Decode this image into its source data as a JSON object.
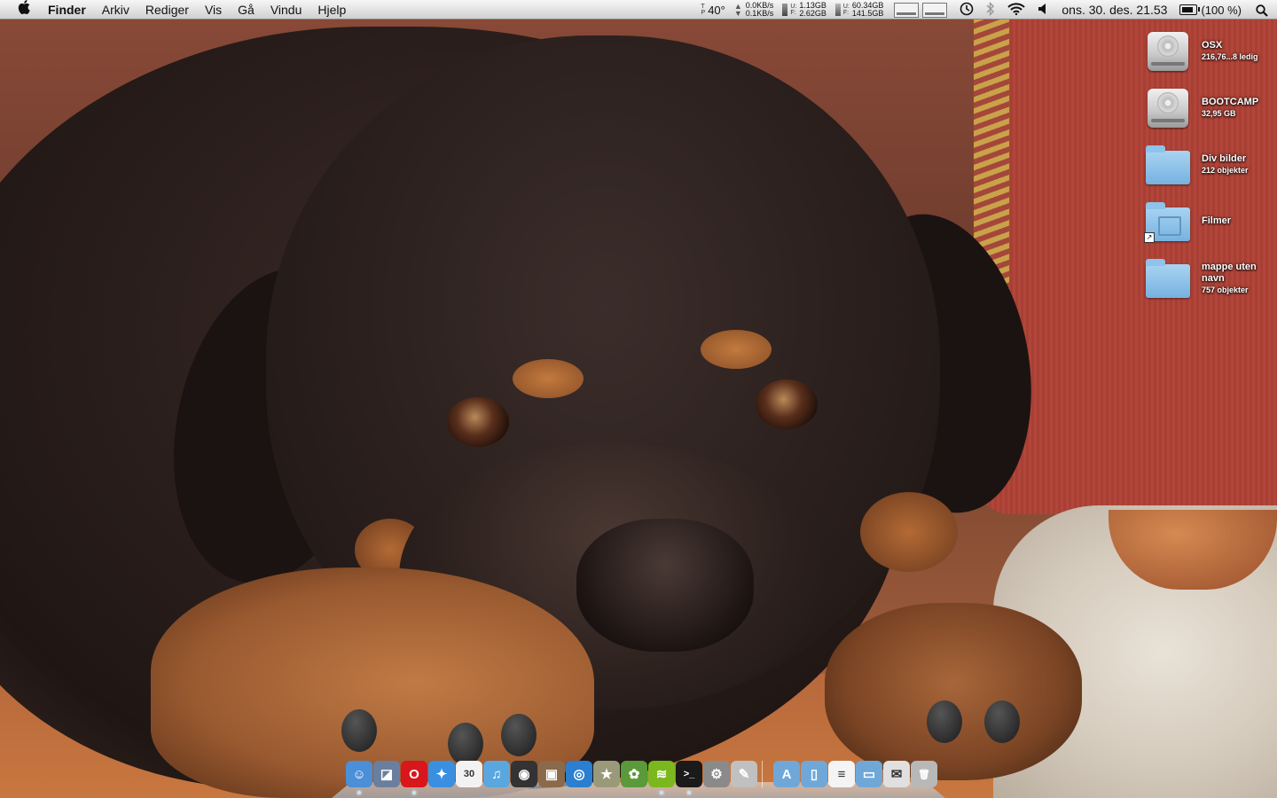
{
  "menubar": {
    "app_name": "Finder",
    "menus": [
      "Arkiv",
      "Rediger",
      "Vis",
      "Gå",
      "Vindu",
      "Hjelp"
    ],
    "temperature_label": [
      "T",
      "P"
    ],
    "temperature": "40°",
    "network": {
      "up": "0.0KB/s",
      "down": "0.1KB/s"
    },
    "memory": {
      "labels": [
        "U:",
        "F:"
      ],
      "used": "1.13GB",
      "free": "2.62GB"
    },
    "disk": {
      "labels": [
        "U:",
        "F:"
      ],
      "used": "60.34GB",
      "free": "141.5GB"
    },
    "clock": "ons. 30. des.  21.53",
    "battery": "(100 %)"
  },
  "desktop_icons": [
    {
      "name": "OSX",
      "sub": "216,76...8 ledig",
      "type": "drive"
    },
    {
      "name": "BOOTCAMP",
      "sub": "32,95 GB",
      "type": "drive"
    },
    {
      "name": "Div bilder",
      "sub": "212 objekter",
      "type": "folder"
    },
    {
      "name": "Filmer",
      "sub": "",
      "type": "movies-alias"
    },
    {
      "name": "mappe uten navn",
      "sub": "757 objekter",
      "type": "folder"
    }
  ],
  "dock": {
    "apps": [
      {
        "name": "finder",
        "bg": "#4a8fd8",
        "glyph": "☺",
        "running": true
      },
      {
        "name": "preview",
        "bg": "#6a7fa0",
        "glyph": "◪",
        "running": false
      },
      {
        "name": "opera",
        "bg": "#d8161b",
        "glyph": "O",
        "running": true
      },
      {
        "name": "safari",
        "bg": "#3a8fe0",
        "glyph": "✦",
        "running": false
      },
      {
        "name": "ical",
        "bg": "#f2f2f2",
        "glyph": "30",
        "running": false
      },
      {
        "name": "itunes",
        "bg": "#5aa7e0",
        "glyph": "♫",
        "running": false
      },
      {
        "name": "camera",
        "bg": "#333333",
        "glyph": "◉",
        "running": false
      },
      {
        "name": "iphoto",
        "bg": "#8a6a4a",
        "glyph": "▣",
        "running": false
      },
      {
        "name": "dvd-player",
        "bg": "#2a7fd0",
        "glyph": "◎",
        "running": false
      },
      {
        "name": "imovie-star",
        "bg": "#9a9a7a",
        "glyph": "★",
        "running": false
      },
      {
        "name": "adium",
        "bg": "#5a9a3a",
        "glyph": "✿",
        "running": false
      },
      {
        "name": "spotify",
        "bg": "#7ab81e",
        "glyph": "≋",
        "running": true
      },
      {
        "name": "terminal",
        "bg": "#1a1a1a",
        "glyph": ">_",
        "running": true
      },
      {
        "name": "system-preferences",
        "bg": "#8a8a8a",
        "glyph": "⚙",
        "running": false
      },
      {
        "name": "photo-booth",
        "bg": "#c0c0c0",
        "glyph": "✎",
        "running": false
      }
    ],
    "stacks": [
      {
        "name": "applications-stack",
        "bg": "#6fa8d8",
        "glyph": "A"
      },
      {
        "name": "documents-stack",
        "bg": "#6fa8d8",
        "glyph": "▯"
      },
      {
        "name": "text-document",
        "bg": "#f4f4f4",
        "glyph": "≡"
      },
      {
        "name": "folder-stack",
        "bg": "#6fa8d8",
        "glyph": "▭"
      },
      {
        "name": "mail-stack",
        "bg": "#e0e0e0",
        "glyph": "✉"
      },
      {
        "name": "trash",
        "bg": "#b8b8b8",
        "glyph": "🗑"
      }
    ]
  }
}
